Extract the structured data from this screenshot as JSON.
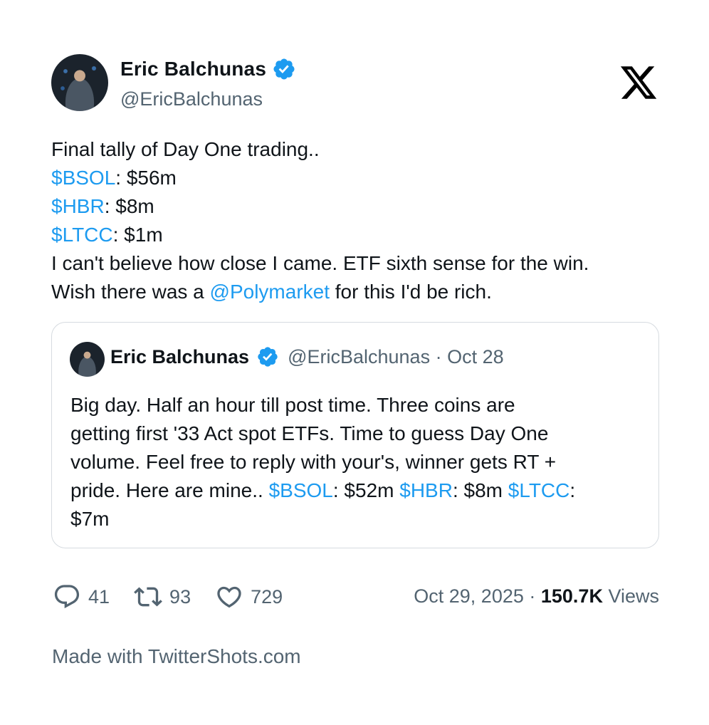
{
  "author": {
    "name": "Eric Balchunas",
    "handle": "@EricBalchunas"
  },
  "tweet": {
    "line1": "Final tally of Day One trading..",
    "line2_tag": "$BSOL",
    "line2_rest": ": $56m",
    "line3_tag": "$HBR",
    "line3_rest": ": $8m",
    "line4_tag": "$LTCC",
    "line4_rest": ": $1m",
    "line5": "I can't believe how close I came. ETF sixth sense for the win.",
    "line6_pre": "Wish there was a ",
    "line6_mention": "@Polymarket",
    "line6_post": " for this I'd be rich."
  },
  "quote": {
    "name": "Eric Balchunas",
    "handle_date": "@EricBalchunas · Oct 28",
    "line1": "Big day. Half an hour till post time. Three coins are",
    "line2": "getting first '33 Act spot ETFs. Time to guess Day One",
    "line3": "volume. Feel free to reply with your's, winner gets RT +",
    "line4_pre": "pride. Here are mine.. ",
    "line4_tag1": "$BSOL",
    "line4_mid1": ": $52m ",
    "line4_tag2": "$HBR",
    "line4_mid2": ": $8m ",
    "line4_tag3": "$LTCC",
    "line4_post": ":",
    "line5": "$7m"
  },
  "stats": {
    "replies": "41",
    "retweets": "93",
    "likes": "729",
    "date": "Oct 29, 2025 · ",
    "views_count": "150.7K",
    "views_label": " Views"
  },
  "footer": "Made with TwitterShots.com",
  "icons": {
    "verified": "verified-badge-icon",
    "x_logo": "x-logo-icon",
    "reply": "reply-icon",
    "retweet": "retweet-icon",
    "like": "heart-icon"
  },
  "colors": {
    "link": "#1d9bf0",
    "muted": "#536471",
    "text": "#0f1419"
  }
}
